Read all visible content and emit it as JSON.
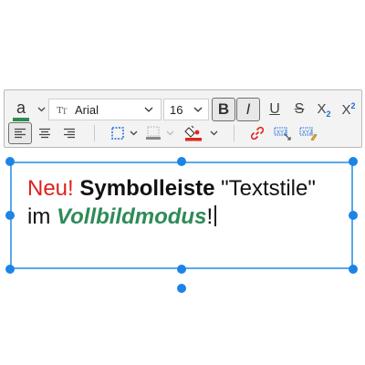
{
  "toolbar": {
    "font_color_label": "a",
    "font_color_value": "#2e8b4f",
    "font_family": "Arial",
    "font_family_icon": "font-type-icon",
    "font_size": "16",
    "bold_label": "B",
    "italic_label": "I",
    "underline_label": "U",
    "strikethrough_label": "S",
    "subscript_label": "X",
    "subscript_sub": "2",
    "superscript_label": "X",
    "superscript_sup": "2",
    "bold_active": true,
    "italic_active": true,
    "align_left_active": true,
    "icons": [
      "align-left-icon",
      "align-center-icon",
      "align-right-icon",
      "border-icon",
      "border-style-icon",
      "fill-color-icon",
      "link-icon",
      "text-field-icon",
      "text-field-edit-icon"
    ]
  },
  "editor": {
    "line1": {
      "accent": "Neu!",
      "bold": "Symbolleiste",
      "plain": "\"Textstile\""
    },
    "line2": {
      "plain": "im",
      "bold_italic": "Vollbildmodus",
      "end": "!"
    }
  },
  "colors": {
    "accent_red": "#e0201b",
    "accent_green": "#2e8b57",
    "selection_blue": "#1b84e6",
    "icon_blue": "#1b6fd6",
    "link_red": "#e0261b"
  }
}
